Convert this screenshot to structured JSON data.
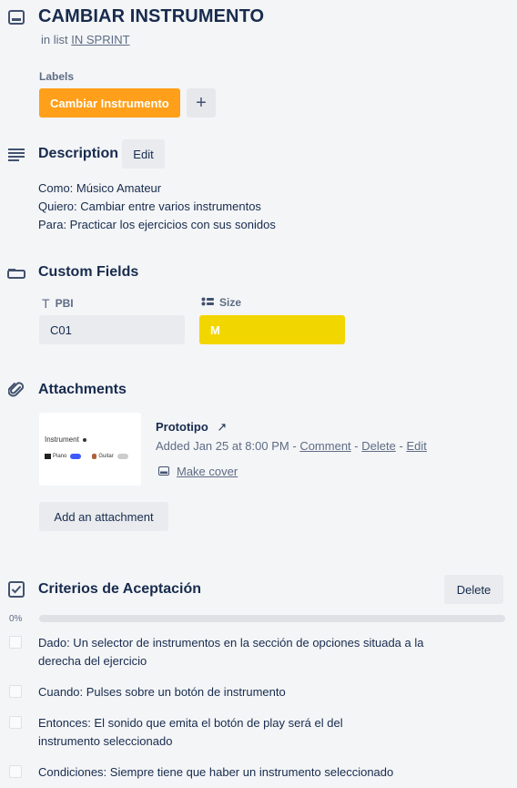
{
  "card": {
    "title": "CAMBIAR INSTRUMENTO",
    "in_list_prefix": "in list",
    "list_name": "IN SPRINT"
  },
  "labels": {
    "heading": "Labels",
    "items": [
      {
        "text": "Cambiar Instrumento",
        "color": "#ff9f1a"
      }
    ],
    "add_symbol": "+"
  },
  "description": {
    "heading": "Description",
    "edit_label": "Edit",
    "lines": [
      "Como: Músico Amateur",
      "Quiero: Cambiar entre varios instrumentos",
      "Para: Practicar los ejercicios con sus sonidos"
    ]
  },
  "custom_fields": {
    "heading": "Custom Fields",
    "fields": [
      {
        "name": "PBI",
        "value": "C01"
      },
      {
        "name": "Size",
        "value": "M",
        "color": "#f2d600"
      }
    ]
  },
  "attachments": {
    "heading": "Attachments",
    "items": [
      {
        "name": "Prototipo",
        "open_icon": "↗",
        "added_text": "Added Jan 25 at 8:00 PM",
        "sep": "-",
        "comment_link": "Comment",
        "delete_link": "Delete",
        "edit_link": "Edit",
        "make_cover": "Make cover",
        "thumb": {
          "title": "Instrument",
          "opt1": "Piano",
          "opt2": "Guitar"
        }
      }
    ],
    "add_label": "Add an attachment"
  },
  "checklist": {
    "heading": "Criterios de Aceptación",
    "delete_label": "Delete",
    "progress_percent": 0,
    "progress_text": "0%",
    "items": [
      {
        "text": "Dado: Un selector de instrumentos en la sección de opciones situada a la derecha del ejercicio",
        "checked": false
      },
      {
        "text": "Cuando: Pulses sobre un botón de instrumento",
        "checked": false
      },
      {
        "text": "Entonces: El sonido que emita el botón de play será el del instrumento seleccionado",
        "checked": false
      },
      {
        "text": "Condiciones: Siempre tiene que haber un instrumento seleccionado",
        "checked": false
      }
    ]
  }
}
